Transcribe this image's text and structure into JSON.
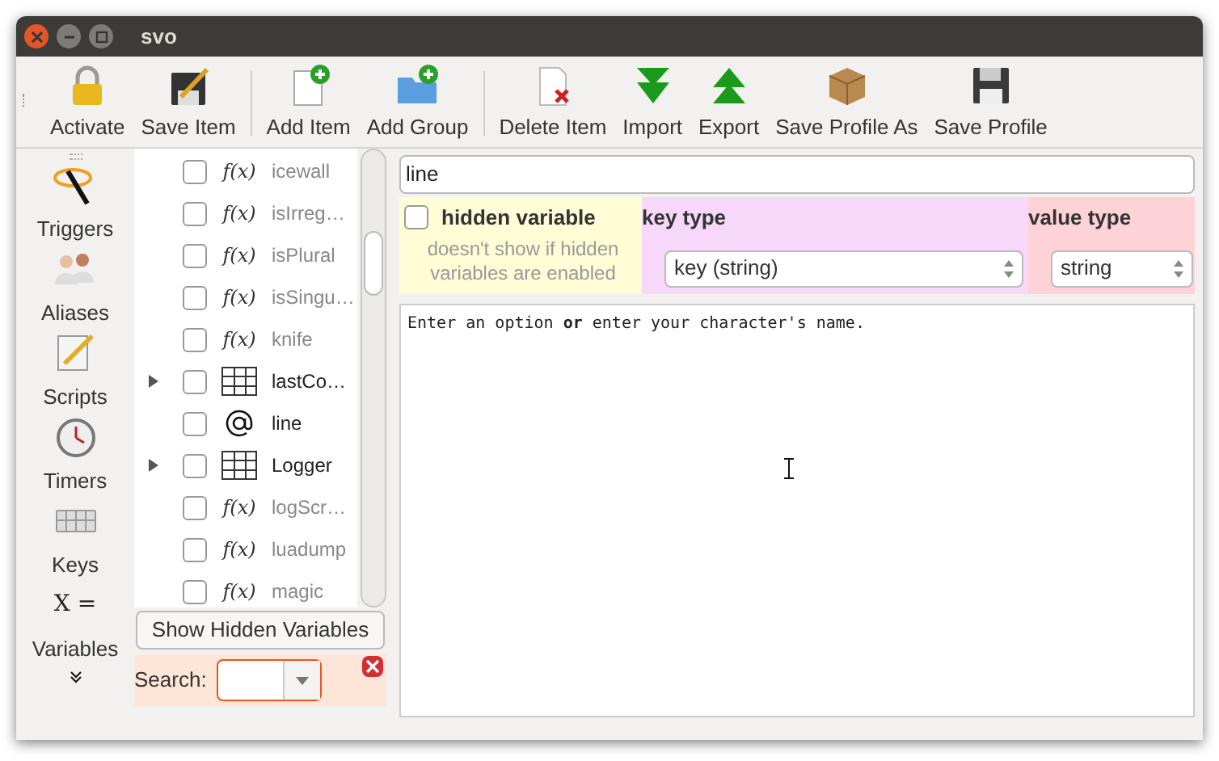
{
  "window": {
    "title": "svo"
  },
  "toolbar": [
    [
      {
        "label": "Activate"
      },
      {
        "label": "Save Item"
      }
    ],
    [
      {
        "label": "Add Item"
      },
      {
        "label": "Add Group"
      }
    ],
    [
      {
        "label": "Delete Item"
      },
      {
        "label": "Import"
      },
      {
        "label": "Export"
      },
      {
        "label": "Save Profile As"
      },
      {
        "label": "Save Profile"
      }
    ]
  ],
  "sidebar": {
    "items": [
      {
        "label": "Triggers"
      },
      {
        "label": "Aliases"
      },
      {
        "label": "Scripts"
      },
      {
        "label": "Timers"
      },
      {
        "label": "Keys"
      },
      {
        "label": "Variables",
        "glyph": "X ="
      }
    ]
  },
  "tree": {
    "items": [
      {
        "name": "icewall",
        "kind": "function",
        "glyph": "f(x)",
        "checked": false
      },
      {
        "name": "isIrreg…",
        "kind": "function",
        "glyph": "f(x)",
        "checked": false
      },
      {
        "name": "isPlural",
        "kind": "function",
        "glyph": "f(x)",
        "checked": false
      },
      {
        "name": "isSingu…",
        "kind": "function",
        "glyph": "f(x)",
        "checked": false
      },
      {
        "name": "knife",
        "kind": "function",
        "glyph": "f(x)",
        "checked": false
      },
      {
        "name": "lastCo…",
        "kind": "table",
        "checked": false,
        "expanded": false
      },
      {
        "name": "line",
        "kind": "string",
        "checked": false
      },
      {
        "name": "Logger",
        "kind": "table",
        "checked": false,
        "expanded": false
      },
      {
        "name": "logScr…",
        "kind": "function",
        "glyph": "f(x)",
        "checked": false
      },
      {
        "name": "luadump",
        "kind": "function",
        "glyph": "f(x)",
        "checked": false
      },
      {
        "name": "magic",
        "kind": "function",
        "glyph": "f(x)",
        "checked": false
      }
    ]
  },
  "show_hidden_button": "Show Hidden Variables",
  "search": {
    "label": "Search:"
  },
  "editor": {
    "name": "line",
    "hidden_variable": {
      "label": "hidden variable",
      "checked": false,
      "hint": "doesn't show if hidden variables are enabled"
    },
    "key_type": {
      "label": "key type",
      "value": "key (string)"
    },
    "value_type": {
      "label": "value type",
      "value": "string"
    },
    "code": "Enter an option **or** enter your character's name."
  }
}
